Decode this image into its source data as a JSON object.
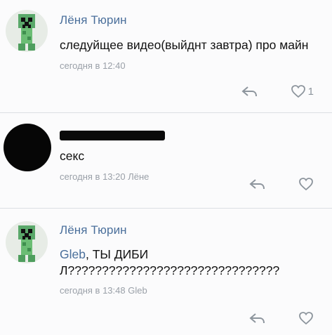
{
  "comments": [
    {
      "author": "Лёня Тюрин",
      "text": "следуйщее видео(выйднт завтра) про майн",
      "meta": "сегодня в 12:40",
      "likes": "1",
      "avatar": "creeper-avatar"
    },
    {
      "author": "",
      "text": "секс",
      "meta": "сегодня в 13:20 Лёне",
      "likes": "",
      "avatar": "black-avatar"
    },
    {
      "author": "Лёня Тюрин",
      "mention": "Gleb",
      "text": ", ТЫ ДИБИЛ???????????????????????????????",
      "meta": "сегодня в 13:48 Gleb",
      "likes": "",
      "avatar": "creeper-avatar"
    }
  ],
  "icons": {
    "reply": "reply-arrow-icon",
    "like": "heart-icon"
  },
  "colors": {
    "link": "#4a6f9b",
    "meta": "#9aa0a8",
    "background": "#fbfbfc"
  }
}
